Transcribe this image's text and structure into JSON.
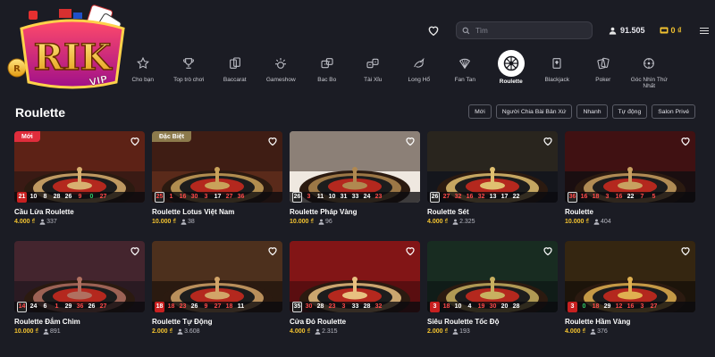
{
  "logo": {
    "text": "RIK",
    "sub": "VIP"
  },
  "header": {
    "search_placeholder": "Tìm",
    "balance": "91.505",
    "coins": "0 ₫"
  },
  "categories": [
    {
      "label": "Cho bạn",
      "icon": "star-icon"
    },
    {
      "label": "Top trò chơi",
      "icon": "trophy-icon"
    },
    {
      "label": "Baccarat",
      "icon": "baccarat-icon"
    },
    {
      "label": "Gameshow",
      "icon": "gameshow-icon"
    },
    {
      "label": "Bac Bo",
      "icon": "dice-icon"
    },
    {
      "label": "Tài Xỉu",
      "icon": "dice-pair-icon"
    },
    {
      "label": "Long Hổ",
      "icon": "dragon-icon"
    },
    {
      "label": "Fan Tan",
      "icon": "fan-icon"
    },
    {
      "label": "Roulette",
      "icon": "roulette-icon",
      "active": true
    },
    {
      "label": "Blackjack",
      "icon": "cards-icon"
    },
    {
      "label": "Poker",
      "icon": "poker-chip-icon"
    },
    {
      "label": "Góc Nhìn Thứ Nhất",
      "icon": "first-person-icon"
    }
  ],
  "section": {
    "title": "Roulette",
    "filters": [
      "Mới",
      "Người Chia Bài Bản Xứ",
      "Nhanh",
      "Tự động",
      "Salon Privé"
    ]
  },
  "games": [
    {
      "name": "Cầu Lửa Roulette",
      "bet": "4.000 ₫",
      "players": "337",
      "badge": "Mới",
      "badge_type": "new",
      "numbers": [
        [
          "21",
          "redbg"
        ],
        [
          "10",
          "black"
        ],
        [
          "8",
          "black"
        ],
        [
          "28",
          "black"
        ],
        [
          "26",
          "black"
        ],
        [
          "9",
          "red"
        ],
        [
          "0",
          "green"
        ],
        [
          "27",
          "red"
        ]
      ]
    },
    {
      "name": "Roulette Lotus Việt Nam",
      "bet": "10.000 ₫",
      "players": "38",
      "badge": "Đặc Biệt",
      "badge_type": "special",
      "numbers": [
        [
          "25",
          "red"
        ],
        [
          "1",
          "red"
        ],
        [
          "16",
          "red"
        ],
        [
          "30",
          "red"
        ],
        [
          "3",
          "red"
        ],
        [
          "17",
          "black"
        ],
        [
          "27",
          "red"
        ],
        [
          "36",
          "red"
        ]
      ]
    },
    {
      "name": "Roulette Pháp Vàng",
      "bet": "10.000 ₫",
      "players": "96",
      "numbers": [
        [
          "26",
          "black"
        ],
        [
          "3",
          "red"
        ],
        [
          "11",
          "black"
        ],
        [
          "10",
          "black"
        ],
        [
          "31",
          "black"
        ],
        [
          "33",
          "black"
        ],
        [
          "24",
          "black"
        ],
        [
          "23",
          "red"
        ]
      ]
    },
    {
      "name": "Roulette Sét",
      "bet": "4.000 ₫",
      "players": "2.325",
      "numbers": [
        [
          "26",
          "black"
        ],
        [
          "27",
          "red"
        ],
        [
          "32",
          "red"
        ],
        [
          "16",
          "red"
        ],
        [
          "32",
          "red"
        ],
        [
          "13",
          "black"
        ],
        [
          "17",
          "black"
        ],
        [
          "22",
          "black"
        ]
      ]
    },
    {
      "name": "Roulette",
      "bet": "10.000 ₫",
      "players": "404",
      "numbers": [
        [
          "36",
          "red"
        ],
        [
          "16",
          "red"
        ],
        [
          "18",
          "red"
        ],
        [
          "3",
          "red"
        ],
        [
          "16",
          "red"
        ],
        [
          "22",
          "black"
        ],
        [
          "7",
          "red"
        ],
        [
          "5",
          "red"
        ]
      ]
    },
    {
      "name": "Roulette Đắm Chìm",
      "bet": "10.000 ₫",
      "players": "891",
      "numbers": [
        [
          "14",
          "red"
        ],
        [
          "24",
          "black"
        ],
        [
          "6",
          "black"
        ],
        [
          "1",
          "red"
        ],
        [
          "29",
          "black"
        ],
        [
          "36",
          "red"
        ],
        [
          "26",
          "black"
        ],
        [
          "27",
          "red"
        ]
      ]
    },
    {
      "name": "Roulette Tự Động",
      "bet": "2.000 ₫",
      "players": "3.608",
      "numbers": [
        [
          "18",
          "redbg"
        ],
        [
          "18",
          "red"
        ],
        [
          "23",
          "red"
        ],
        [
          "26",
          "black"
        ],
        [
          "9",
          "red"
        ],
        [
          "27",
          "red"
        ],
        [
          "18",
          "red"
        ],
        [
          "11",
          "black"
        ]
      ]
    },
    {
      "name": "Cửa Đỏ Roulette",
      "bet": "4.000 ₫",
      "players": "2.315",
      "numbers": [
        [
          "35",
          "black"
        ],
        [
          "30",
          "red"
        ],
        [
          "28",
          "black"
        ],
        [
          "23",
          "red"
        ],
        [
          "3",
          "red"
        ],
        [
          "33",
          "black"
        ],
        [
          "28",
          "black"
        ],
        [
          "32",
          "red"
        ]
      ]
    },
    {
      "name": "Siêu Roulette Tốc Độ",
      "bet": "2.000 ₫",
      "players": "193",
      "numbers": [
        [
          "3",
          "redbg"
        ],
        [
          "18",
          "red"
        ],
        [
          "10",
          "black"
        ],
        [
          "4",
          "black"
        ],
        [
          "19",
          "red"
        ],
        [
          "30",
          "red"
        ],
        [
          "20",
          "black"
        ],
        [
          "28",
          "black"
        ]
      ]
    },
    {
      "name": "Roulette Hầm Vàng",
      "bet": "4.000 ₫",
      "players": "376",
      "numbers": [
        [
          "3",
          "redbg"
        ],
        [
          "0",
          "green"
        ],
        [
          "18",
          "red"
        ],
        [
          "29",
          "black"
        ],
        [
          "12",
          "red"
        ],
        [
          "16",
          "red"
        ],
        [
          "3",
          "red"
        ],
        [
          "27",
          "red"
        ]
      ]
    }
  ],
  "colors": {
    "background": "#1b1c24",
    "accent_gold": "#f2c230",
    "new_badge": "#e02d3c",
    "special_badge": "#8c7a4c"
  }
}
